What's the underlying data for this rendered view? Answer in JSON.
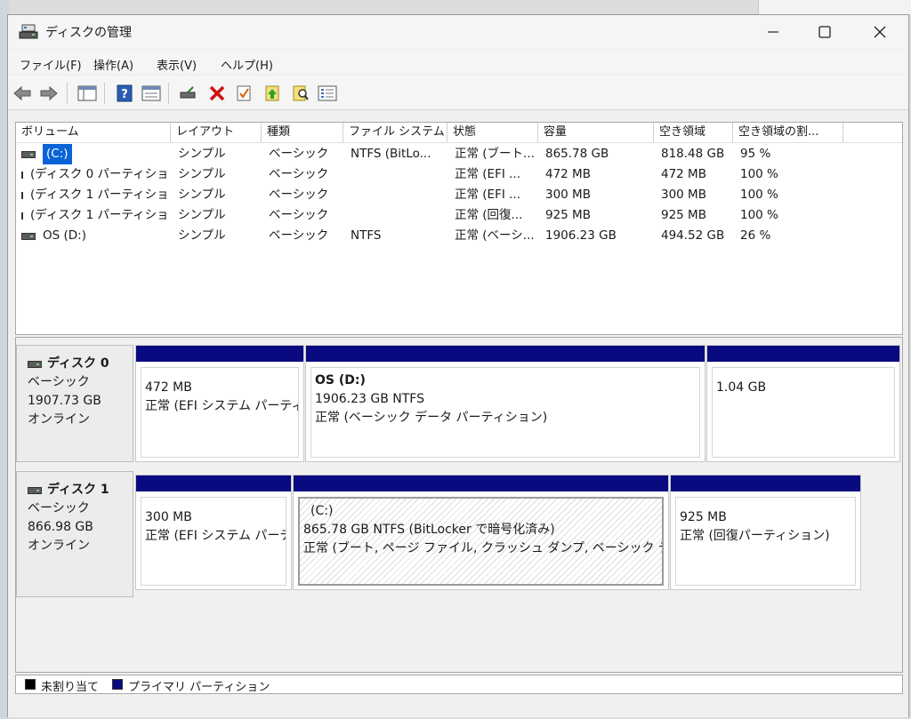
{
  "window": {
    "title": "ディスクの管理"
  },
  "menu": [
    "ファイル(F)",
    "操作(A)",
    "表示(V)",
    "ヘルプ(H)"
  ],
  "columns": [
    "ボリューム",
    "レイアウト",
    "種類",
    "ファイル システム",
    "状態",
    "容量",
    "空き領域",
    "空き領域の割..."
  ],
  "volumes": [
    {
      "name": "(C:)",
      "layout": "シンプル",
      "type": "ベーシック",
      "fs": "NTFS (BitLo...",
      "status": "正常 (ブート...",
      "capacity": "865.78 GB",
      "free": "818.48 GB",
      "pct": "95 %"
    },
    {
      "name": "(ディスク 0 パーティショ...",
      "layout": "シンプル",
      "type": "ベーシック",
      "fs": "",
      "status": "正常 (EFI ...",
      "capacity": "472 MB",
      "free": "472 MB",
      "pct": "100 %"
    },
    {
      "name": "(ディスク 1 パーティショ...",
      "layout": "シンプル",
      "type": "ベーシック",
      "fs": "",
      "status": "正常 (EFI ...",
      "capacity": "300 MB",
      "free": "300 MB",
      "pct": "100 %"
    },
    {
      "name": "(ディスク 1 パーティショ...",
      "layout": "シンプル",
      "type": "ベーシック",
      "fs": "",
      "status": "正常 (回復...",
      "capacity": "925 MB",
      "free": "925 MB",
      "pct": "100 %"
    },
    {
      "name": "OS (D:)",
      "layout": "シンプル",
      "type": "ベーシック",
      "fs": "NTFS",
      "status": "正常 (ベーシ...",
      "capacity": "1906.23 GB",
      "free": "494.52 GB",
      "pct": "26 %"
    }
  ],
  "disks": [
    {
      "name": "ディスク 0",
      "type": "ベーシック",
      "size": "1907.73 GB",
      "state": "オンライン",
      "partitions": [
        {
          "title": "",
          "line1": "472 MB",
          "line2": "正常 (EFI システム パーティション)"
        },
        {
          "title": "OS  (D:)",
          "line1": "1906.23 GB NTFS",
          "line2": "正常 (ベーシック データ パーティション)"
        },
        {
          "title": "",
          "line1": "1.04 GB",
          "line2": ""
        }
      ]
    },
    {
      "name": "ディスク 1",
      "type": "ベーシック",
      "size": "866.98 GB",
      "state": "オンライン",
      "partitions": [
        {
          "title": "",
          "line1": "300 MB",
          "line2": "正常 (EFI システム パーティション)"
        },
        {
          "title": "(C:)",
          "line1": "865.78 GB NTFS (BitLocker で暗号化済み)",
          "line2": "正常 (ブート, ページ ファイル, クラッシュ ダンプ, ベーシック データ パーティション)"
        },
        {
          "title": "",
          "line1": "925 MB",
          "line2": "正常 (回復パーティション)"
        }
      ]
    }
  ],
  "legend": [
    {
      "label": "未割り当て",
      "color": "#000000"
    },
    {
      "label": "プライマリ パーティション",
      "color": "#0a0a80"
    }
  ],
  "icons": [
    "back-arrow-icon",
    "forward-arrow-icon",
    "console-tree-icon",
    "help-icon",
    "properties-icon",
    "connect-drive-icon",
    "delete-icon",
    "check-icon",
    "upload-icon",
    "search-icon",
    "list-icon"
  ]
}
